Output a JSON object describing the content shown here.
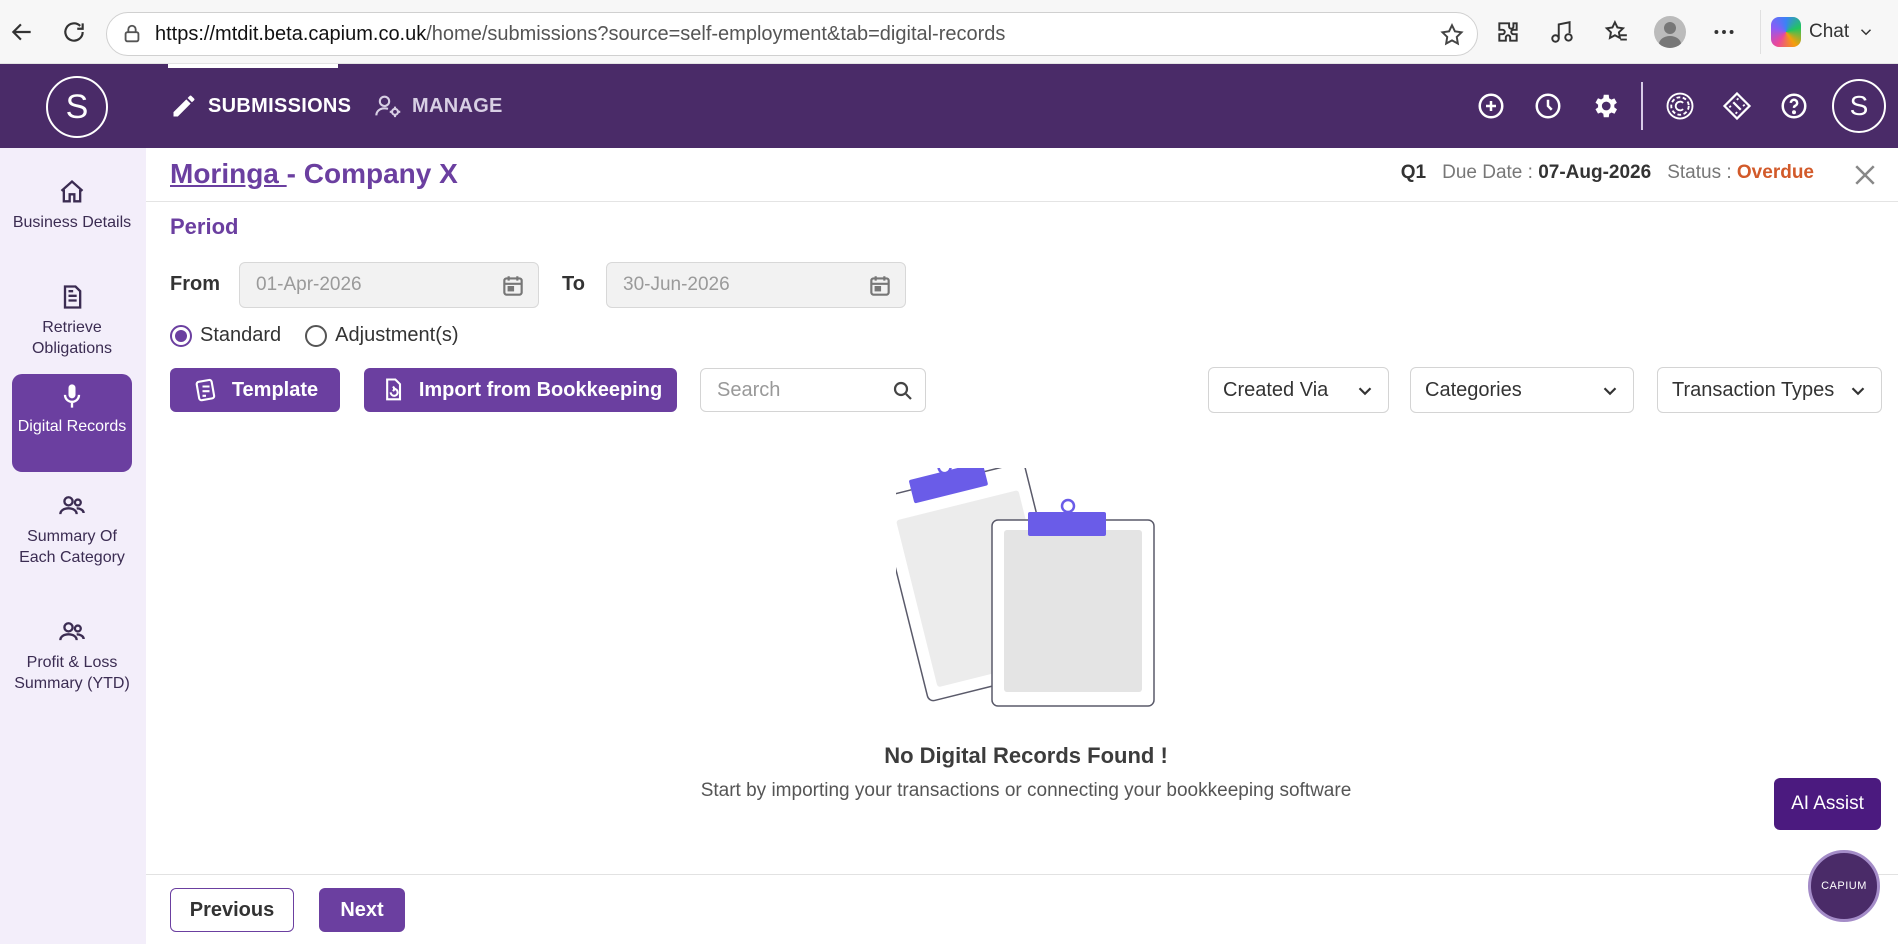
{
  "browser": {
    "url_host": "https://mtdit.beta.capium.co.uk",
    "url_path": "/home/submissions?source=self-employment&tab=digital-records",
    "chat_label": "Chat"
  },
  "header": {
    "brand_initial": "S",
    "tabs": [
      {
        "label": "SUBMISSIONS",
        "icon": "pencil-icon",
        "active": true
      },
      {
        "label": "MANAGE",
        "icon": "user-gear-icon",
        "active": false
      }
    ],
    "user_initial": "S",
    "icons": [
      "plus-circle-icon",
      "clock-icon",
      "gear-icon",
      "capium-logo-icon",
      "ticket-icon",
      "help-icon"
    ]
  },
  "sidebar": {
    "items": [
      {
        "label": "Business Details",
        "icon": "home-icon",
        "active": false
      },
      {
        "label": "Retrieve Obligations",
        "icon": "document-icon",
        "active": false
      },
      {
        "label": "Digital Records",
        "icon": "microphone-icon",
        "active": true
      },
      {
        "label": "Summary Of Each Category",
        "icon": "people-icon",
        "active": false
      },
      {
        "label": "Profit & Loss Summary (YTD)",
        "icon": "people-icon",
        "active": false
      }
    ]
  },
  "main": {
    "client_name": "Moringa ",
    "company_name": "- Company X",
    "quarter": "Q1",
    "due_date_label": "Due Date :",
    "due_date": "07-Aug-2026",
    "status_label": "Status :",
    "status": "Overdue",
    "period_label": "Period",
    "from_label": "From",
    "from_date": "01-Apr-2026",
    "to_label": "To",
    "to_date": "30-Jun-2026",
    "radio_standard": "Standard",
    "radio_adjustment": "Adjustment(s)",
    "template_button": "Template",
    "import_button": "Import from Bookkeeping",
    "search_placeholder": "Search",
    "filter_created_via": "Created Via",
    "filter_categories": "Categories",
    "filter_transaction_types": "Transaction Types",
    "empty_title": "No Digital Records Found !",
    "empty_subtitle": "Start by importing your transactions or connecting your bookkeeping software",
    "ai_assist": "AI Assist",
    "previous_button": "Previous",
    "next_button": "Next",
    "capium_bubble": "CAPIUM"
  },
  "colors": {
    "brand_purple": "#4a2b68",
    "accent_purple": "#6b3fa0",
    "overdue": "#d25a2a",
    "sidebar_bg": "#f3eefa"
  }
}
